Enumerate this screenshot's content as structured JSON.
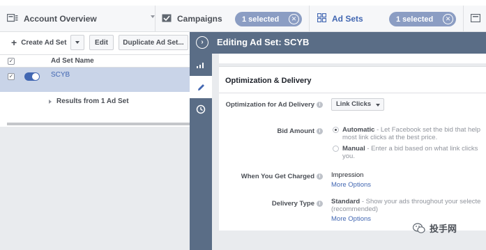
{
  "topbar": {
    "account_tab": {
      "label": "Account Overview",
      "icon": "account-overview-icon"
    },
    "campaigns_tab": {
      "label": "Campaigns",
      "icon": "campaigns-check-icon",
      "selected_label": "1 selected"
    },
    "adsets_tab": {
      "label": "Ad Sets",
      "icon": "adsets-grid-icon",
      "selected_label": "1 selected"
    }
  },
  "toolbar": {
    "create_label": "Create Ad Set",
    "edit_label": "Edit",
    "duplicate_label": "Duplicate Ad Set..."
  },
  "table": {
    "column_header": "Ad Set Name",
    "rows": [
      {
        "name": "SCYB",
        "checked": true,
        "on": true
      }
    ],
    "results_label": "Results from 1 Ad Set"
  },
  "editor": {
    "title": "Editing Ad Set: SCYB",
    "rail": [
      "chart-icon",
      "pencil-icon",
      "clock-icon"
    ],
    "section_title": "Optimization & Delivery",
    "fields": {
      "optimization_label": "Optimization for Ad Delivery",
      "optimization_value": "Link Clicks",
      "bid_label": "Bid Amount",
      "bid_auto_title": "Automatic",
      "bid_auto_line1": " - Let Facebook set the bid that help",
      "bid_auto_line2": "most link clicks at the best price.",
      "bid_manual_title": "Manual",
      "bid_manual_line1": " - Enter a bid based on what link clicks",
      "bid_manual_line2": "you.",
      "charged_label": "When You Get Charged",
      "charged_value": "Impression",
      "charged_more": "More Options",
      "delivery_label": "Delivery Type",
      "delivery_title": "Standard",
      "delivery_line1": " - Show your ads throughout your selecte",
      "delivery_line2": "(recommended)",
      "delivery_more": "More Options"
    }
  },
  "watermark": {
    "text": "投手网"
  },
  "colors": {
    "accent": "#4267b2",
    "panel": "#5a6d86",
    "selected_row": "#c9d4e8",
    "pill": "#8b9dc3"
  }
}
